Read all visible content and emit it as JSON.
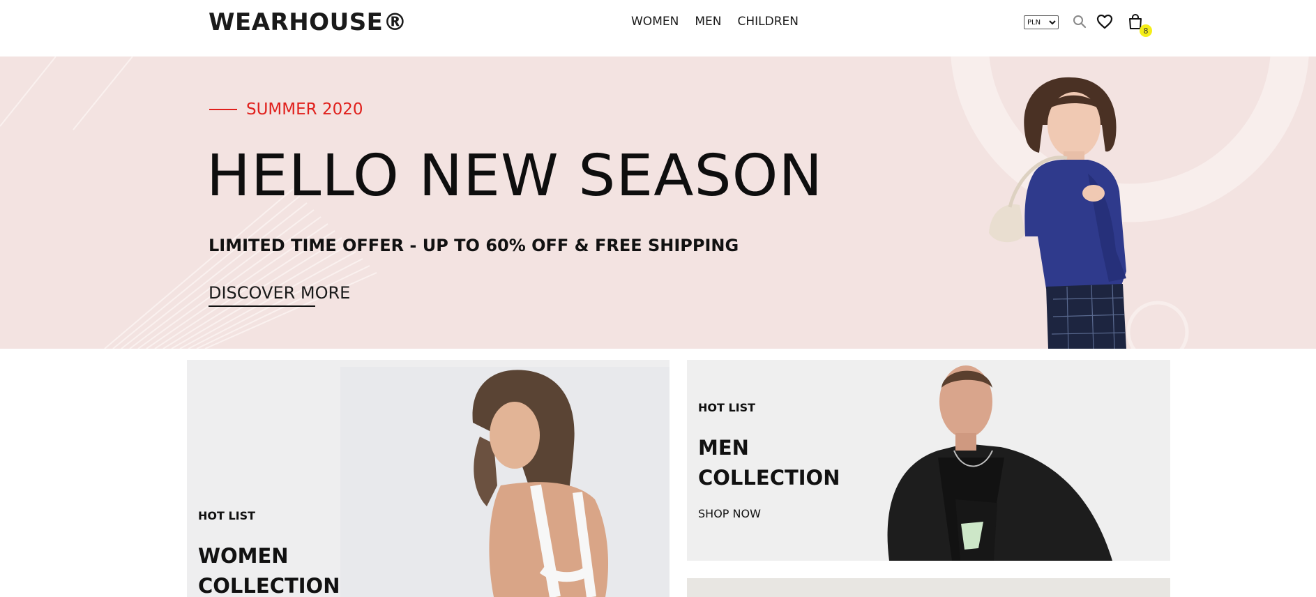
{
  "header": {
    "logo": "WEARHOUSE®",
    "nav": [
      "WOMEN",
      "MEN",
      "CHILDREN"
    ],
    "currency": "PLN",
    "currency_options": [
      "PLN"
    ],
    "cart_count": "8",
    "icons": {
      "search": "search-icon",
      "wishlist": "heart-icon",
      "cart": "shopping-bag-icon"
    }
  },
  "hero": {
    "kicker": "SUMMER 2020",
    "title": "HELLO NEW SEASON",
    "subtitle": "LIMITED TIME OFFER - UP TO 60% OFF & FREE SHIPPING",
    "cta": "DISCOVER MORE",
    "accent_color": "#e0201c",
    "background_color": "#f3e3e1"
  },
  "collections": {
    "women": {
      "label": "HOT LIST",
      "title_line1": "WOMEN",
      "title_line2": "COLLECTION"
    },
    "men": {
      "label": "HOT LIST",
      "title_line1": "MEN",
      "title_line2": "COLLECTION",
      "cta": "SHOP NOW"
    }
  },
  "colors": {
    "badge": "#f5ee18",
    "text": "#111111"
  }
}
